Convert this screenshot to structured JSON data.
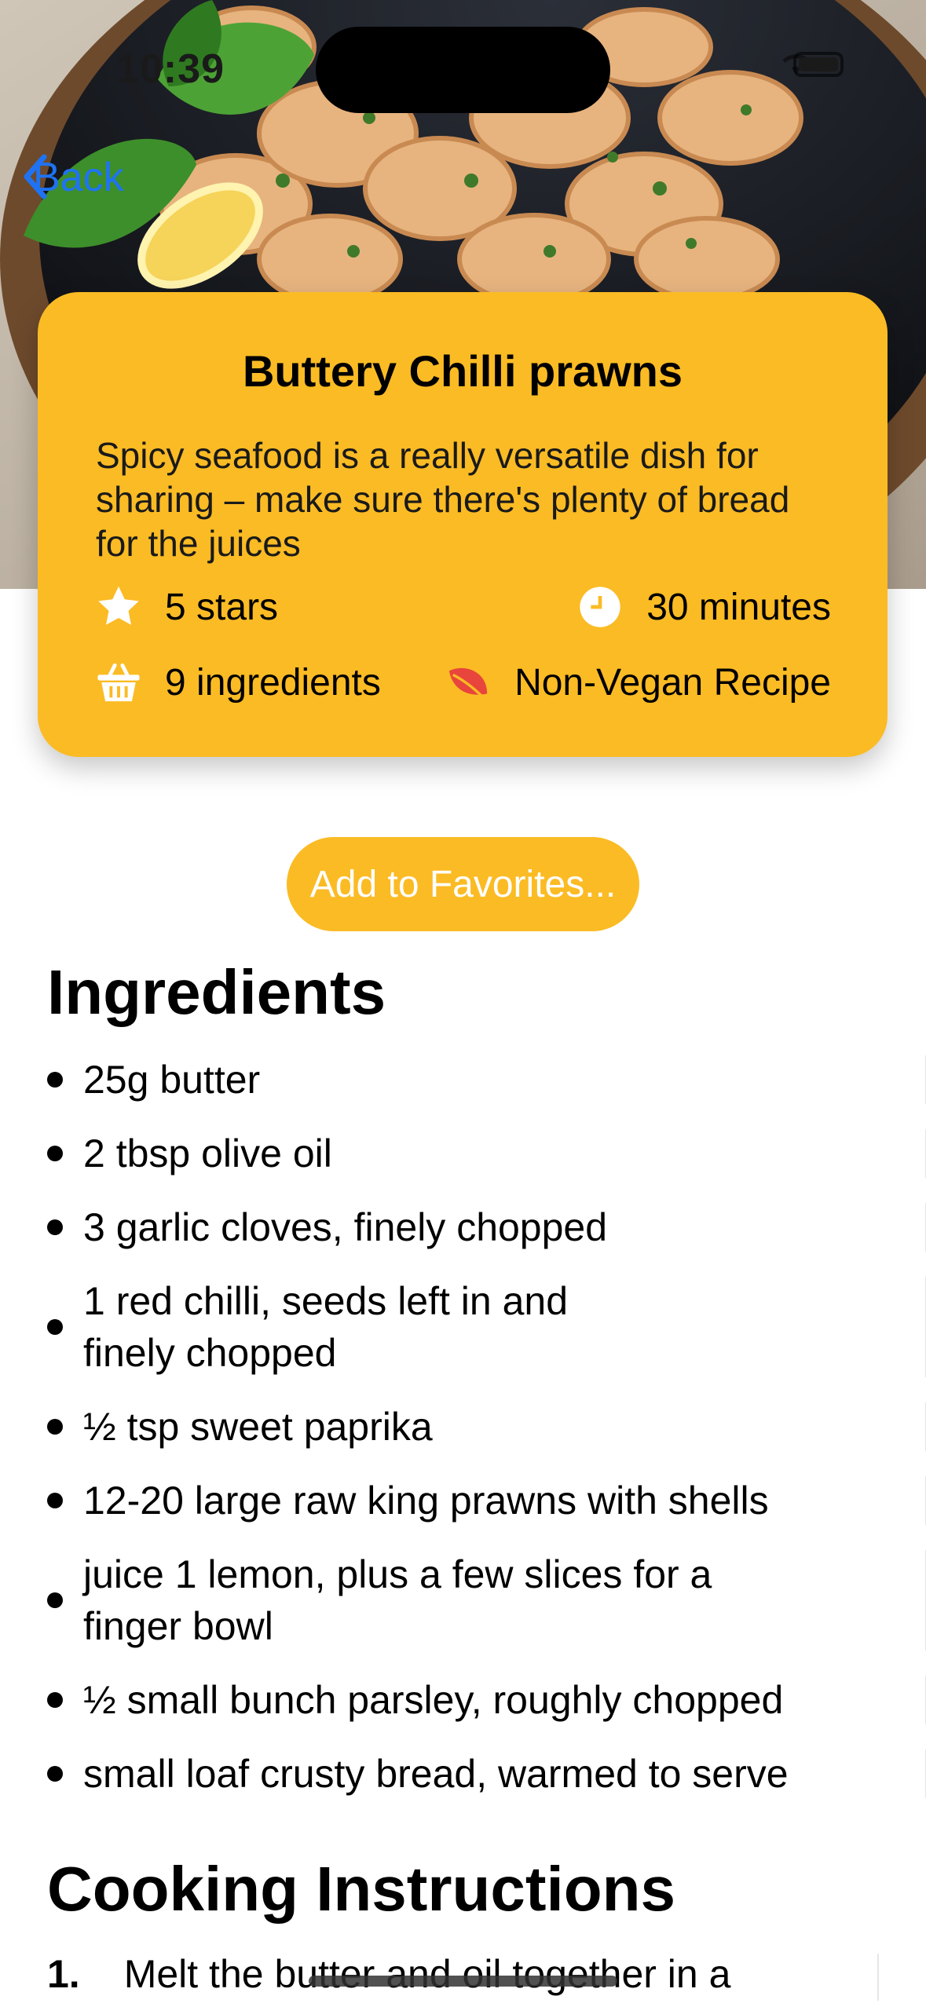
{
  "status_bar": {
    "time": "10:39"
  },
  "nav": {
    "back_label": "Back"
  },
  "recipe": {
    "title": "Buttery Chilli prawns",
    "description": "Spicy seafood is a really versatile dish for sharing – make sure there's plenty of bread for the juices",
    "rating": "5 stars",
    "time": "30 minutes",
    "ingredients_count": "9 ingredients",
    "diet": "Non-Vegan Recipe"
  },
  "actions": {
    "favorites_label": "Add to Favorites..."
  },
  "ingredients_section": {
    "heading": "Ingredients",
    "items": [
      "25g butter",
      "2 tbsp olive oil",
      "3 garlic cloves, finely chopped",
      "1 red chilli, seeds left in and finely chopped",
      "½ tsp sweet paprika",
      "12-20 large raw king prawns with shells",
      "juice 1 lemon, plus a few slices for a finger bowl",
      "½ small bunch parsley, roughly chopped",
      "small loaf crusty bread, warmed to serve"
    ]
  },
  "instructions_section": {
    "heading": "Cooking Instructions",
    "steps": [
      {
        "number": "1.",
        "text": "Melt the butter and oil together in a"
      }
    ]
  },
  "colors": {
    "accent": "#fbbb24",
    "link": "#1f73f3",
    "diet_leaf": "#e8453c"
  },
  "icons": [
    "star-icon",
    "clock-icon",
    "basket-icon",
    "leaf-icon",
    "chevron-left-icon"
  ]
}
